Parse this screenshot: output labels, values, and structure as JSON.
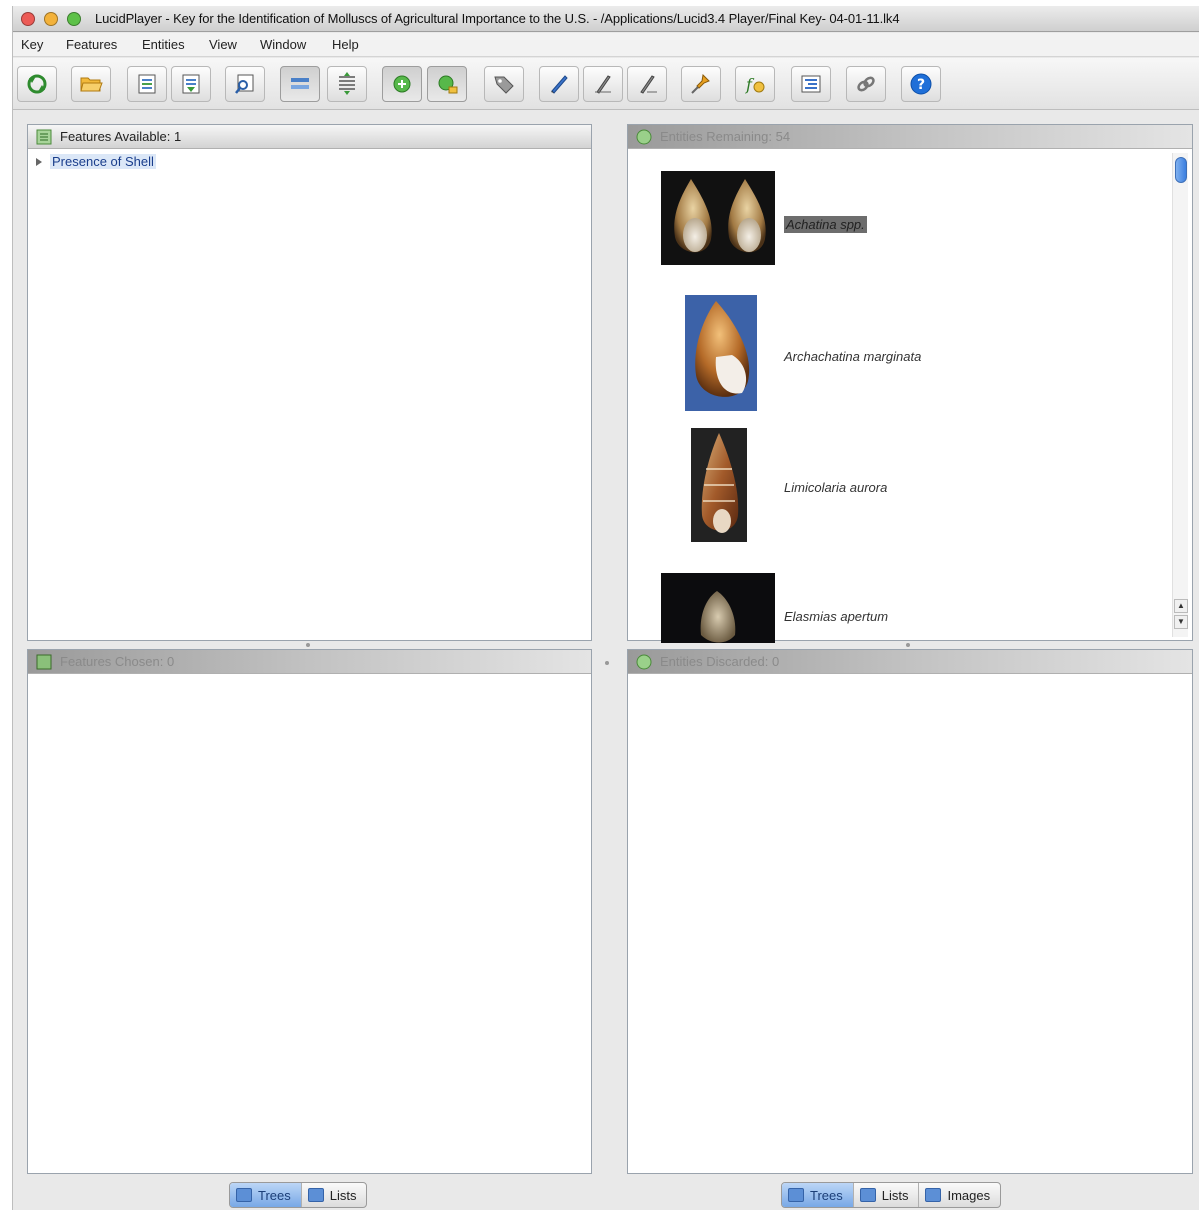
{
  "window": {
    "title": "LucidPlayer - Key for the Identification of Molluscs of Agricultural Importance to the U.S. - /Applications/Lucid3.4 Player/Final Key- 04-01-11.lk4",
    "traffic_lights": [
      "#ec5b56",
      "#f3b23b",
      "#5dc148"
    ]
  },
  "menu": [
    "Key",
    "Features",
    "Entities",
    "View",
    "Window",
    "Help"
  ],
  "toolbar": {
    "buttons": [
      {
        "icon": "restart-key-icon"
      },
      {
        "icon": "open-folder-icon"
      },
      {
        "icon": "document-list-icon"
      },
      {
        "icon": "document-arrows-icon"
      },
      {
        "icon": "magnify-document-icon"
      },
      {
        "icon": "single-pane-icon",
        "pressed": true
      },
      {
        "icon": "list-arrows-icon"
      },
      {
        "icon": "feature-green-icon",
        "pressed": true
      },
      {
        "icon": "feature-green-user-icon",
        "pressed": true
      },
      {
        "icon": "tag-icon"
      },
      {
        "icon": "pen-icon"
      },
      {
        "icon": "stylus-left-icon"
      },
      {
        "icon": "stylus-right-icon"
      },
      {
        "icon": "pin-icon"
      },
      {
        "icon": "function-icon"
      },
      {
        "icon": "list-settings-icon"
      },
      {
        "icon": "link-icon"
      },
      {
        "icon": "help-icon"
      }
    ]
  },
  "features_panel": {
    "header": "Features Available: 1",
    "tree": [
      {
        "label": "Presence of Shell"
      }
    ]
  },
  "features_chosen_panel": {
    "header": "Features Chosen: 0"
  },
  "entities_remaining_panel": {
    "header": "Entities Remaining: 54",
    "items": [
      {
        "name": "Achatina spp.",
        "selected": true
      },
      {
        "name": "Archachatina marginata",
        "selected": false
      },
      {
        "name": "Limicolaria aurora",
        "selected": false
      },
      {
        "name": "Elasmias apertum",
        "selected": false
      }
    ]
  },
  "entities_discarded_panel": {
    "header": "Entities Discarded: 0"
  },
  "left_tabs": [
    {
      "label": "Trees",
      "active": true
    },
    {
      "label": "Lists",
      "active": false
    }
  ],
  "right_tabs": [
    {
      "label": "Trees",
      "active": true
    },
    {
      "label": "Lists",
      "active": false
    },
    {
      "label": "Images",
      "active": false
    }
  ]
}
